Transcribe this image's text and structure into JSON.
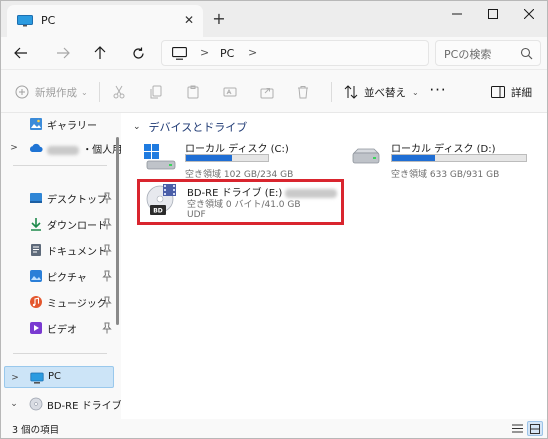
{
  "window": {
    "tab_title": "PC",
    "tab_close_glyph": "✕",
    "new_tab_glyph": "+",
    "minimize_icon": "minimize-icon",
    "maximize_icon": "maximize-icon",
    "close_icon": "close-icon"
  },
  "address": {
    "separator": ">",
    "crumbs": [
      "PC"
    ],
    "search_placeholder": "PCの検索"
  },
  "toolbar": {
    "new_label": "新規作成",
    "sort_label": "並べ替え",
    "more_glyph": "···",
    "details_label": "詳細",
    "chevron": "⌄"
  },
  "sidebar": {
    "items": [
      {
        "label": "ギャラリー",
        "icon": "gallery-icon",
        "expandable": false
      },
      {
        "label": "・個人用",
        "icon": "onedrive-icon",
        "expandable": true,
        "obscured_prefix": true
      },
      {
        "label": "デスクトップ",
        "icon": "desktop-folder-icon",
        "pinned": true
      },
      {
        "label": "ダウンロード",
        "icon": "download-icon",
        "pinned": true
      },
      {
        "label": "ドキュメント",
        "icon": "documents-icon",
        "pinned": true
      },
      {
        "label": "ピクチャ",
        "icon": "pictures-icon",
        "pinned": true
      },
      {
        "label": "ミュージック",
        "icon": "music-icon",
        "pinned": true
      },
      {
        "label": "ビデオ",
        "icon": "videos-icon",
        "pinned": true
      },
      {
        "label": "PC",
        "icon": "pc-icon",
        "expandable": true,
        "selected": true
      },
      {
        "label": "BD-RE ドライブ (E",
        "icon": "bd-drive-icon",
        "expandable": true,
        "expanded": true
      }
    ]
  },
  "main": {
    "group_label": "デバイスとドライブ",
    "group_chevron": "⌄",
    "drives": [
      {
        "name": "ローカル ディスク (C:)",
        "free_text": "空き領域 102 GB/234 GB",
        "used_fraction": 0.564,
        "icon": "windows-drive-icon"
      },
      {
        "name": "ローカル ディスク (D:)",
        "free_text": "空き領域 633 GB/931 GB",
        "used_fraction": 0.32,
        "icon": "hdd-icon"
      },
      {
        "name": "BD-RE ドライブ (E:)",
        "free_text": "空き領域 0 バイト/41.0 GB",
        "filesystem": "UDF",
        "icon": "bd-disc-icon",
        "disc_badge": "BD",
        "volume_label_obscured": true
      }
    ]
  },
  "status": {
    "item_count": "3 個の項目"
  },
  "colors": {
    "accent": "#1f6ed4",
    "highlight_border": "#d9252e",
    "selection_bg": "#cce4f7"
  }
}
